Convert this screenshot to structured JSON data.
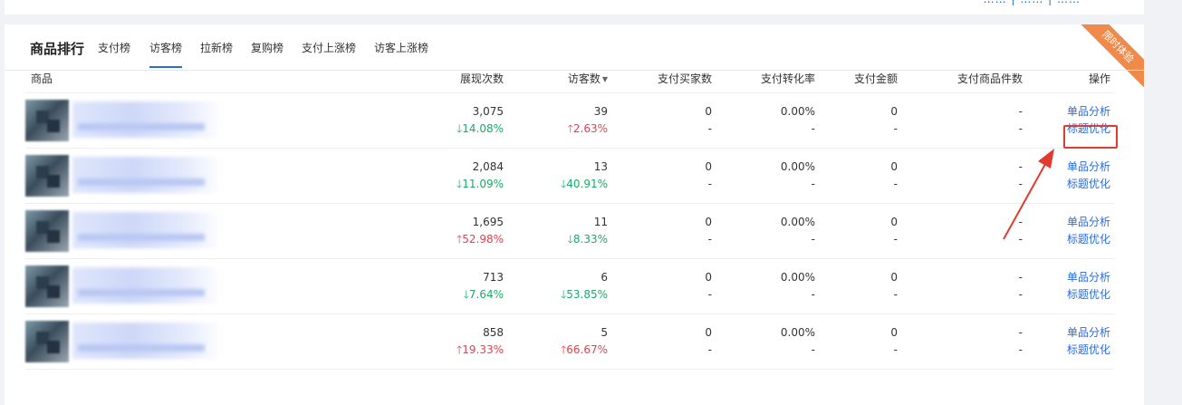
{
  "top": {
    "links": "…… | …… | ……"
  },
  "card": {
    "title": "商品排行",
    "ribbon": "限时体验",
    "tabs": [
      {
        "label": "支付榜",
        "active": false
      },
      {
        "label": "访客榜",
        "active": true
      },
      {
        "label": "拉新榜",
        "active": false
      },
      {
        "label": "复购榜",
        "active": false
      },
      {
        "label": "支付上涨榜",
        "active": false
      },
      {
        "label": "访客上涨榜",
        "active": false
      }
    ]
  },
  "table": {
    "headers": [
      "商品",
      "展现次数",
      "访客数",
      "支付买家数",
      "支付转化率",
      "支付金额",
      "支付商品件数",
      "操作"
    ],
    "sort_icon": "sort-desc-icon",
    "rows": [
      {
        "views": "3,075",
        "views_chg": "14.08%",
        "views_dir": "down",
        "visitors": "39",
        "visitors_chg": "2.63%",
        "visitors_dir": "up",
        "buyers": "0",
        "buyers_sub": "-",
        "conv": "0.00%",
        "conv_sub": "-",
        "amount": "0",
        "amount_sub": "-",
        "items": "-",
        "items_sub": "-",
        "act1": "单品分析",
        "act2": "标题优化"
      },
      {
        "views": "2,084",
        "views_chg": "11.09%",
        "views_dir": "down",
        "visitors": "13",
        "visitors_chg": "40.91%",
        "visitors_dir": "down",
        "buyers": "0",
        "buyers_sub": "-",
        "conv": "0.00%",
        "conv_sub": "-",
        "amount": "0",
        "amount_sub": "-",
        "items": "-",
        "items_sub": "-",
        "act1": "单品分析",
        "act2": "标题优化"
      },
      {
        "views": "1,695",
        "views_chg": "52.98%",
        "views_dir": "up",
        "visitors": "11",
        "visitors_chg": "8.33%",
        "visitors_dir": "down",
        "buyers": "0",
        "buyers_sub": "-",
        "conv": "0.00%",
        "conv_sub": "-",
        "amount": "0",
        "amount_sub": "-",
        "items": "-",
        "items_sub": "-",
        "act1": "单品分析",
        "act2": "标题优化"
      },
      {
        "views": "713",
        "views_chg": "7.64%",
        "views_dir": "down",
        "visitors": "6",
        "visitors_chg": "53.85%",
        "visitors_dir": "down",
        "buyers": "0",
        "buyers_sub": "-",
        "conv": "0.00%",
        "conv_sub": "-",
        "amount": "0",
        "amount_sub": "-",
        "items": "-",
        "items_sub": "-",
        "act1": "单品分析",
        "act2": "标题优化"
      },
      {
        "views": "858",
        "views_chg": "19.33%",
        "views_dir": "up",
        "visitors": "5",
        "visitors_chg": "66.67%",
        "visitors_dir": "up",
        "buyers": "0",
        "buyers_sub": "-",
        "conv": "0.00%",
        "conv_sub": "-",
        "amount": "0",
        "amount_sub": "-",
        "items": "-",
        "items_sub": "-",
        "act1": "单品分析",
        "act2": "标题优化"
      }
    ]
  },
  "colors": {
    "accent": "#2a6bd8",
    "up": "#e5414d",
    "down": "#1aab67",
    "annotation": "#e23a2e",
    "ribbon": "#f08a4b"
  }
}
